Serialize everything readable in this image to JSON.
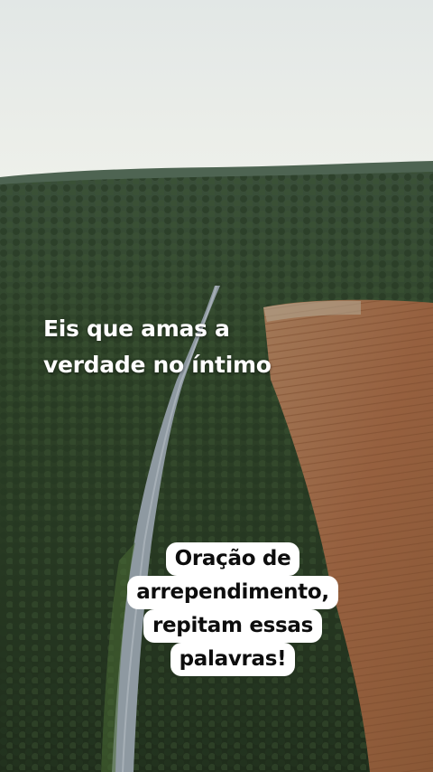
{
  "overlay_text": {
    "top": {
      "line1": "Eis que amas a",
      "line2": "verdade no íntimo"
    },
    "box": {
      "line1": "Oração de",
      "line2": "arrependimento,",
      "line3": "repitam essas",
      "line4": "palavras!"
    }
  },
  "colors": {
    "sky": "#e9ece8",
    "forest": "#2b3d26",
    "field": "#9a6a4a",
    "road": "#8f9aa3",
    "text_light": "#ffffff",
    "text_dark": "#0d0d0d",
    "box": "#ffffff"
  }
}
